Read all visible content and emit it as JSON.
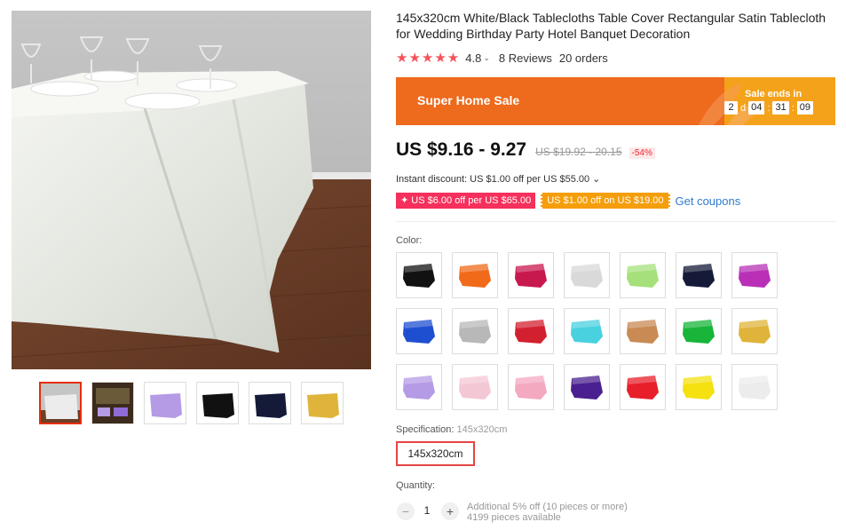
{
  "product": {
    "title": "145x320cm White/Black Tablecloths Table Cover Rectangular Satin Tablecloth for Wedding Birthday Party Hotel Banquet Decoration",
    "rating": "4.8",
    "rating_chevron": "⌄",
    "reviews": "8 Reviews",
    "orders": "20 orders",
    "star_count": 5,
    "star_color": "#f5535a"
  },
  "banner": {
    "title": "Super Home Sale",
    "sale_ends_label": "Sale ends in",
    "days": "2",
    "days_unit": "d",
    "hours": "04",
    "minutes": "31",
    "seconds": "09",
    "colors": {
      "left": "#ee6a1d",
      "right": "#f5a21b"
    }
  },
  "price": {
    "current": "US $9.16 - 9.27",
    "original": "US $19.92 - 20.15",
    "discount": "-54%"
  },
  "instant_discount": "Instant discount: US $1.00 off per US $55.00 ⌄",
  "coupons": [
    {
      "label": "✦ US $6.00 off per US $65.00",
      "color": "#f5305c"
    },
    {
      "label": "US $1.00 off on US $19.00",
      "color": "#f59e0b"
    }
  ],
  "get_coupons": "Get coupons",
  "color_label": "Color:",
  "swatches": [
    {
      "name": "black",
      "color": "#111111"
    },
    {
      "name": "orange",
      "color": "#f06a1a"
    },
    {
      "name": "rose-red",
      "color": "#c8194f"
    },
    {
      "name": "silver-white",
      "color": "#d9d9d9"
    },
    {
      "name": "lime",
      "color": "#a6e07a"
    },
    {
      "name": "navy",
      "color": "#141a38"
    },
    {
      "name": "purple",
      "color": "#b930b7"
    },
    {
      "name": "royal-blue",
      "color": "#1f4fd1"
    },
    {
      "name": "grey",
      "color": "#b8b8b8"
    },
    {
      "name": "red",
      "color": "#d3202f"
    },
    {
      "name": "aqua",
      "color": "#4ad1e0"
    },
    {
      "name": "tan",
      "color": "#c98a54"
    },
    {
      "name": "green",
      "color": "#19b53a"
    },
    {
      "name": "gold",
      "color": "#e0b43a"
    },
    {
      "name": "lavender",
      "color": "#b59be6"
    },
    {
      "name": "light-pink",
      "color": "#f4c7d4"
    },
    {
      "name": "pink",
      "color": "#f3a9c0"
    },
    {
      "name": "violet",
      "color": "#4a1f8f"
    },
    {
      "name": "scarlet",
      "color": "#e81e2a"
    },
    {
      "name": "yellow",
      "color": "#f5e010"
    },
    {
      "name": "white",
      "color": "#ececec"
    }
  ],
  "thumbs": [
    {
      "name": "white-table",
      "color": "#ececec"
    },
    {
      "name": "banquet-scene",
      "color": "#6b5a3a"
    },
    {
      "name": "lavender",
      "color": "#b59be6"
    },
    {
      "name": "black",
      "color": "#111111"
    },
    {
      "name": "navy",
      "color": "#141a38"
    },
    {
      "name": "gold",
      "color": "#e0b43a"
    }
  ],
  "specification": {
    "label": "Specification:",
    "value": "145x320cm",
    "option": "145x320cm"
  },
  "quantity": {
    "label": "Quantity:",
    "minus": "−",
    "value": "1",
    "plus": "+",
    "note_line1": "Additional 5% off (10 pieces or more)",
    "note_line2": "4199 pieces available"
  }
}
